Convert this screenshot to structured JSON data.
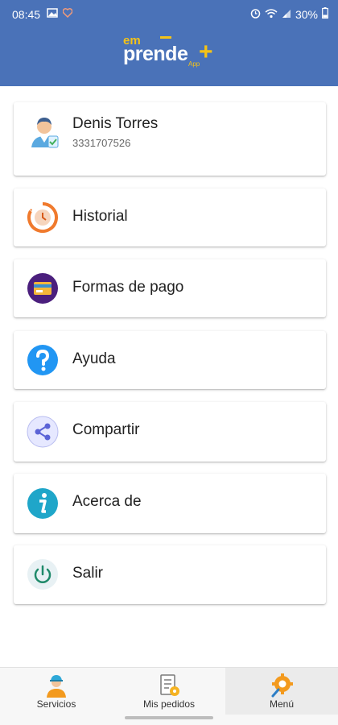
{
  "status_bar": {
    "time": "08:45",
    "battery": "30%",
    "icons": [
      "image-icon",
      "heart-icon",
      "alarm-icon",
      "wifi-icon",
      "signal-icon",
      "battery-icon"
    ]
  },
  "logo": {
    "line1": "em",
    "line2": "prende",
    "plus": "+",
    "app": "App",
    "colors": {
      "accent": "#f5c316",
      "bar": "#4a72b8"
    }
  },
  "profile": {
    "name": "Denis Torres",
    "phone": "3331707526",
    "icon": "user-avatar-icon"
  },
  "menu": {
    "historial": "Historial",
    "formas_pago": "Formas de pago",
    "ayuda": "Ayuda",
    "compartir": "Compartir",
    "acerca": "Acerca de",
    "salir": "Salir"
  },
  "tabs": {
    "servicios": "Servicios",
    "pedidos": "Mis pedidos",
    "menu": "Menú",
    "active": "menu"
  }
}
